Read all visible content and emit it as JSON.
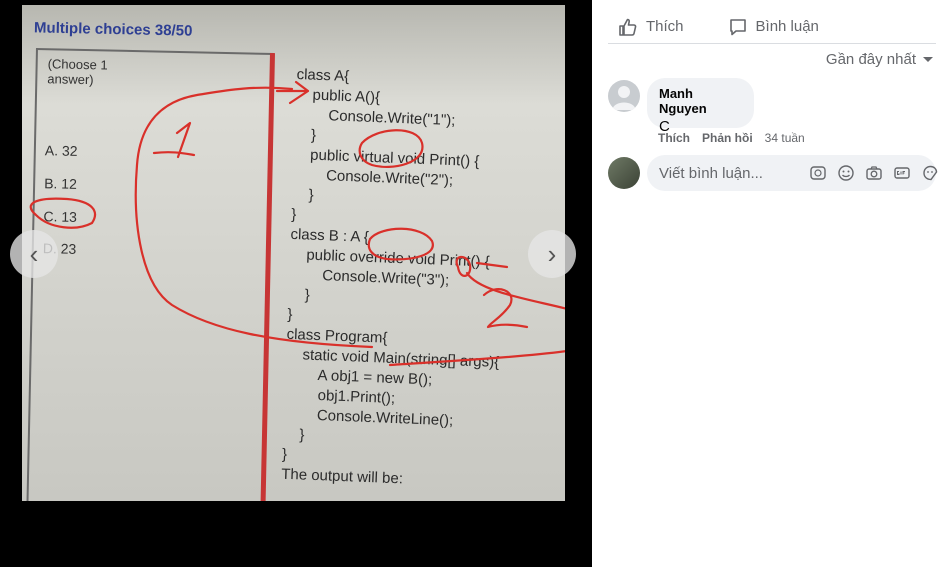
{
  "photo": {
    "header": "Multiple choices 38/50",
    "instruction": "(Choose 1 answer)",
    "options": [
      "A. 32",
      "B. 12",
      "C. 13",
      "D. 23"
    ],
    "code_lines": [
      "class A{",
      "    public A(){",
      "        Console.Write(\"1\");",
      "    }",
      "    public virtual void Print() {",
      "        Console.Write(\"2\");",
      "    }",
      "}",
      "class B : A {",
      "    public override void Print() {",
      "        Console.Write(\"3\");",
      "    }",
      "}",
      "class Program{",
      "    static void Main(string[] args){",
      "        A obj1 = new B();",
      "        obj1.Print();",
      "        Console.WriteLine();",
      "    }",
      "}",
      "The output will be:"
    ]
  },
  "actions": {
    "like_label": "Thích",
    "comment_label": "Bình luận"
  },
  "sort": {
    "label": "Gần đây nhất"
  },
  "comments": [
    {
      "author": "Manh Nguyen",
      "text": "C",
      "like": "Thích",
      "reply": "Phản hồi",
      "time": "34 tuần"
    }
  ],
  "composer": {
    "placeholder": "Viết bình luận..."
  },
  "colors": {
    "annotation_red": "#d9302a",
    "accent_text": "#65676b"
  }
}
